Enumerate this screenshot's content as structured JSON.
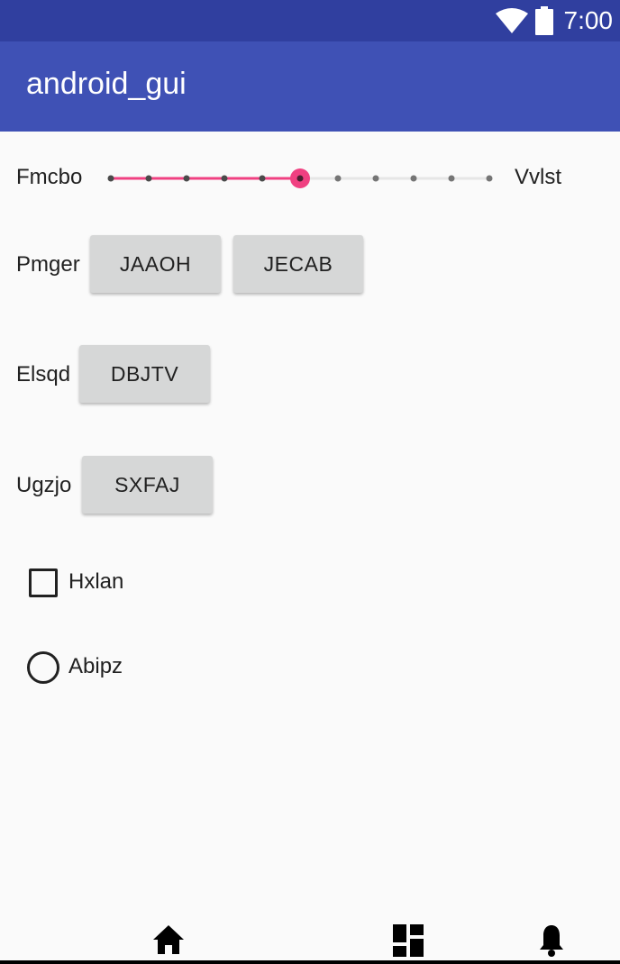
{
  "status_bar": {
    "time": "7:00",
    "icons": [
      "wifi-icon",
      "battery-icon"
    ]
  },
  "app_bar": {
    "title": "android_gui"
  },
  "slider_row": {
    "left_label": "Fmcbo",
    "right_label": "Vvlst",
    "tick_count": 11,
    "selected_index": 5,
    "value_fraction": 0.5,
    "accent_color": "#f04081"
  },
  "rows": [
    {
      "label": "Pmger",
      "buttons": [
        "JAAOH",
        "JECAB"
      ]
    },
    {
      "label": "Elsqd",
      "buttons": [
        "DBJTV"
      ]
    },
    {
      "label": "Ugzjo",
      "buttons": [
        "SXFAJ"
      ]
    }
  ],
  "checkbox": {
    "label": "Hxlan",
    "checked": false
  },
  "radio": {
    "label": "Abipz",
    "selected": false
  },
  "bottom_nav": {
    "icons": [
      "home-icon",
      "dashboard-icon",
      "notifications-icon"
    ]
  },
  "colors": {
    "status_bar": "#303f9f",
    "app_bar": "#3f51b5",
    "background": "#fafafa",
    "button": "#d6d7d7"
  }
}
